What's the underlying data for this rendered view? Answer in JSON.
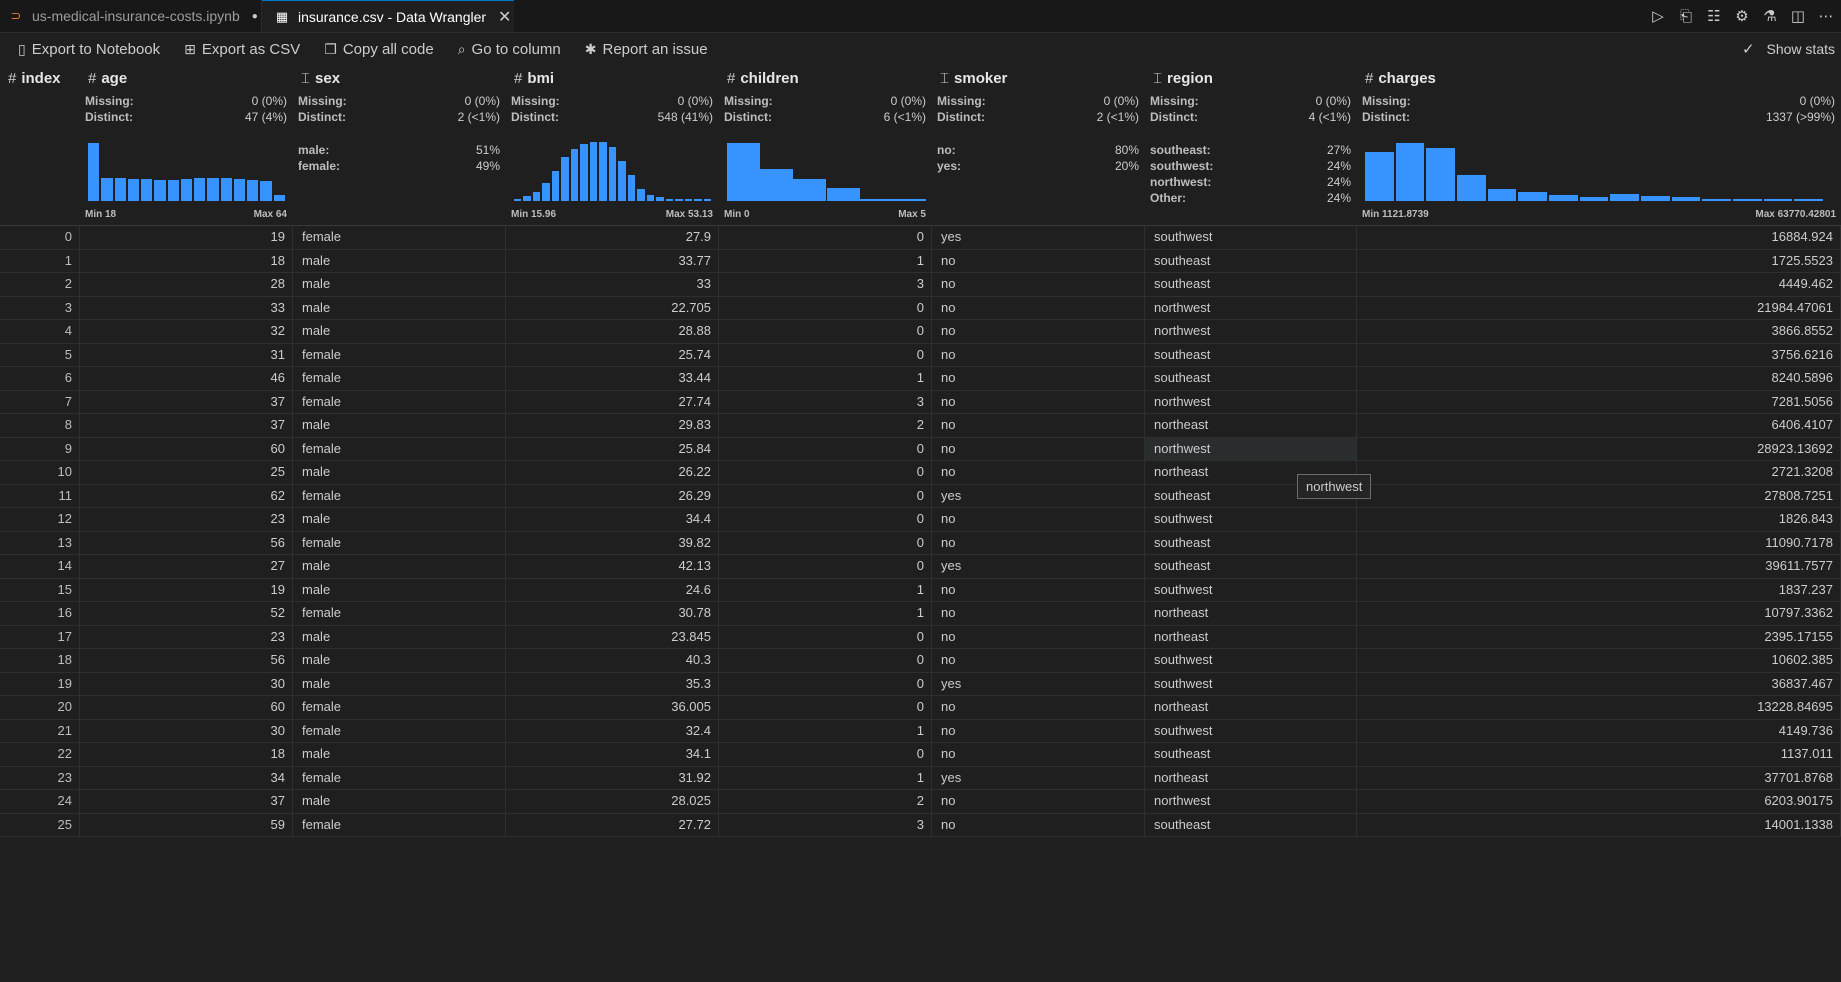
{
  "tabs": [
    {
      "label": "us-medical-insurance-costs.ipynb",
      "icon": "jupyter-icon",
      "dirty": "●"
    },
    {
      "label": "insurance.csv - Data Wrangler",
      "icon": "data-wrangler-icon",
      "close": "✕"
    }
  ],
  "editor_actions": [
    "run-icon",
    "open-changes-icon",
    "split-preview-icon",
    "gear-icon",
    "flask-icon",
    "split-editor-icon",
    "more-icon"
  ],
  "toolbar": {
    "export_notebook": "Export to Notebook",
    "export_csv": "Export as CSV",
    "copy_code": "Copy all code",
    "go_to_column": "Go to column",
    "report_issue": "Report an issue",
    "show_stats": "Show stats"
  },
  "columns": [
    {
      "name": "index",
      "type": "#"
    },
    {
      "name": "age",
      "type": "#",
      "missing": "0 (0%)",
      "distinct": "47 (4%)",
      "min": "Min 18",
      "max": "Max 64",
      "hist": [
        0.95,
        0.37,
        0.37,
        0.36,
        0.36,
        0.35,
        0.35,
        0.36,
        0.37,
        0.38,
        0.37,
        0.36,
        0.34,
        0.33,
        0.1
      ]
    },
    {
      "name": "sex",
      "type": "text",
      "missing": "0 (0%)",
      "distinct": "2 (<1%)",
      "cats": [
        {
          "label": "male:",
          "pct": "51%"
        },
        {
          "label": "female:",
          "pct": "49%"
        }
      ]
    },
    {
      "name": "bmi",
      "type": "#",
      "missing": "0 (0%)",
      "distinct": "548 (41%)",
      "min": "Min 15.96",
      "max": "Max 53.13",
      "hist": [
        0.04,
        0.08,
        0.15,
        0.3,
        0.5,
        0.72,
        0.86,
        0.93,
        0.96,
        0.96,
        0.88,
        0.66,
        0.42,
        0.2,
        0.1,
        0.06,
        0.04,
        0.04,
        0.04,
        0.04,
        0.04
      ]
    },
    {
      "name": "children",
      "type": "#",
      "missing": "0 (0%)",
      "distinct": "6 (<1%)",
      "min": "Min 0",
      "max": "Max 5",
      "hist": [
        0.95,
        0.53,
        0.36,
        0.22,
        0.03,
        0.03
      ]
    },
    {
      "name": "smoker",
      "type": "text",
      "missing": "0 (0%)",
      "distinct": "2 (<1%)",
      "cats": [
        {
          "label": "no:",
          "pct": "80%"
        },
        {
          "label": "yes:",
          "pct": "20%"
        }
      ]
    },
    {
      "name": "region",
      "type": "text",
      "missing": "0 (0%)",
      "distinct": "4 (<1%)",
      "cats": [
        {
          "label": "southeast:",
          "pct": "27%"
        },
        {
          "label": "southwest:",
          "pct": "24%"
        },
        {
          "label": "northwest:",
          "pct": "24%"
        },
        {
          "label": "Other:",
          "pct": "24%"
        }
      ]
    },
    {
      "name": "charges",
      "type": "#",
      "missing": "0 (0%)",
      "distinct": "1337 (>99%)",
      "min": "Min 1121.8739",
      "max": "Max 63770.42801",
      "hist": [
        0.8,
        0.95,
        0.87,
        0.42,
        0.19,
        0.14,
        0.1,
        0.07,
        0.11,
        0.09,
        0.06,
        0.04,
        0.04,
        0.04,
        0.03
      ]
    }
  ],
  "stat_labels": {
    "missing": "Missing:",
    "distinct": "Distinct:"
  },
  "rows": [
    [
      "0",
      "19",
      "female",
      "27.9",
      "0",
      "yes",
      "southwest",
      "16884.924"
    ],
    [
      "1",
      "18",
      "male",
      "33.77",
      "1",
      "no",
      "southeast",
      "1725.5523"
    ],
    [
      "2",
      "28",
      "male",
      "33",
      "3",
      "no",
      "southeast",
      "4449.462"
    ],
    [
      "3",
      "33",
      "male",
      "22.705",
      "0",
      "no",
      "northwest",
      "21984.47061"
    ],
    [
      "4",
      "32",
      "male",
      "28.88",
      "0",
      "no",
      "northwest",
      "3866.8552"
    ],
    [
      "5",
      "31",
      "female",
      "25.74",
      "0",
      "no",
      "southeast",
      "3756.6216"
    ],
    [
      "6",
      "46",
      "female",
      "33.44",
      "1",
      "no",
      "southeast",
      "8240.5896"
    ],
    [
      "7",
      "37",
      "female",
      "27.74",
      "3",
      "no",
      "northwest",
      "7281.5056"
    ],
    [
      "8",
      "37",
      "male",
      "29.83",
      "2",
      "no",
      "northeast",
      "6406.4107"
    ],
    [
      "9",
      "60",
      "female",
      "25.84",
      "0",
      "no",
      "northwest",
      "28923.13692"
    ],
    [
      "10",
      "25",
      "male",
      "26.22",
      "0",
      "no",
      "northeast",
      "2721.3208"
    ],
    [
      "11",
      "62",
      "female",
      "26.29",
      "0",
      "yes",
      "southeast",
      "27808.7251"
    ],
    [
      "12",
      "23",
      "male",
      "34.4",
      "0",
      "no",
      "southwest",
      "1826.843"
    ],
    [
      "13",
      "56",
      "female",
      "39.82",
      "0",
      "no",
      "southeast",
      "11090.7178"
    ],
    [
      "14",
      "27",
      "male",
      "42.13",
      "0",
      "yes",
      "southeast",
      "39611.7577"
    ],
    [
      "15",
      "19",
      "male",
      "24.6",
      "1",
      "no",
      "southwest",
      "1837.237"
    ],
    [
      "16",
      "52",
      "female",
      "30.78",
      "1",
      "no",
      "northeast",
      "10797.3362"
    ],
    [
      "17",
      "23",
      "male",
      "23.845",
      "0",
      "no",
      "northeast",
      "2395.17155"
    ],
    [
      "18",
      "56",
      "male",
      "40.3",
      "0",
      "no",
      "southwest",
      "10602.385"
    ],
    [
      "19",
      "30",
      "male",
      "35.3",
      "0",
      "yes",
      "southwest",
      "36837.467"
    ],
    [
      "20",
      "60",
      "female",
      "36.005",
      "0",
      "no",
      "northeast",
      "13228.84695"
    ],
    [
      "21",
      "30",
      "female",
      "32.4",
      "1",
      "no",
      "southwest",
      "4149.736"
    ],
    [
      "22",
      "18",
      "male",
      "34.1",
      "0",
      "no",
      "southeast",
      "1137.011"
    ],
    [
      "23",
      "34",
      "female",
      "31.92",
      "1",
      "yes",
      "northeast",
      "37701.8768"
    ],
    [
      "24",
      "37",
      "male",
      "28.025",
      "2",
      "no",
      "northwest",
      "6203.90175"
    ],
    [
      "25",
      "59",
      "female",
      "27.72",
      "3",
      "no",
      "southeast",
      "14001.1338"
    ]
  ],
  "hover": {
    "row": 9,
    "col": 6
  },
  "tooltip": "northwest",
  "colors": {
    "bar": "#3794ff",
    "background": "#1f1f1f",
    "tab_accent": "#0078d4"
  }
}
